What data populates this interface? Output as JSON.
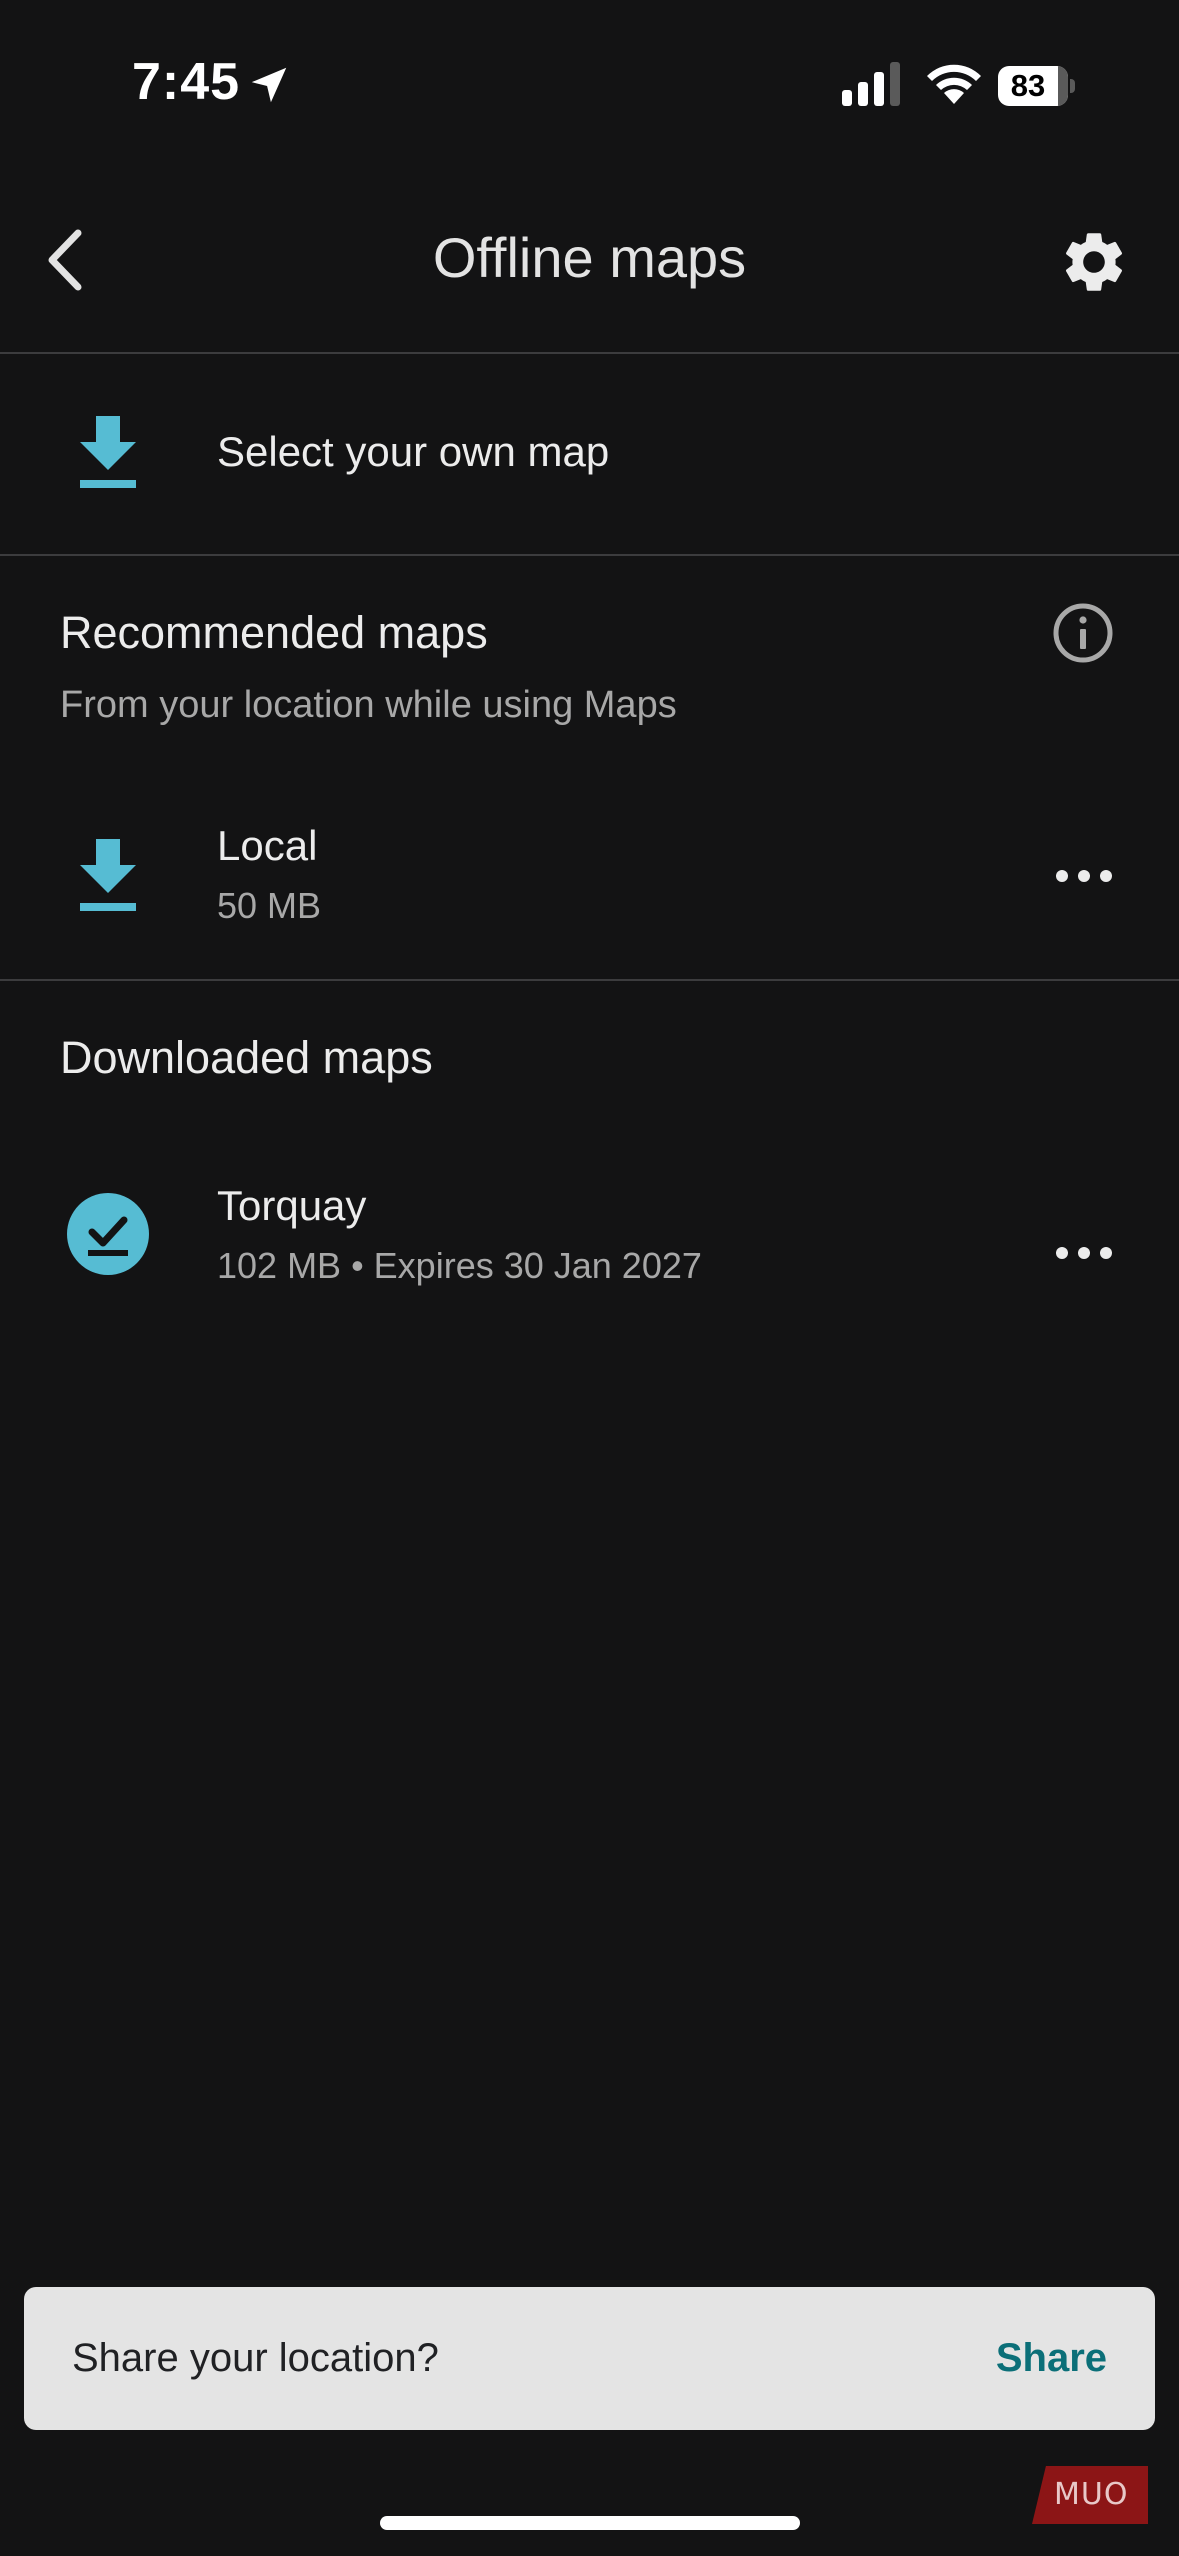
{
  "status_bar": {
    "time": "7:45",
    "battery": "83"
  },
  "header": {
    "title": "Offline maps"
  },
  "select_own_map": {
    "label": "Select your own map"
  },
  "recommended": {
    "title": "Recommended maps",
    "subtitle": "From your location while using Maps",
    "items": [
      {
        "name": "Local",
        "size": "50 MB"
      }
    ]
  },
  "downloaded": {
    "title": "Downloaded maps",
    "items": [
      {
        "name": "Torquay",
        "details": "102 MB • Expires 30 Jan 2027"
      }
    ]
  },
  "share_prompt": {
    "text": "Share your location?",
    "button": "Share"
  },
  "watermark": "MUO",
  "colors": {
    "background": "#131314",
    "accent": "#56bcd3",
    "share_button": "#0b6f78"
  }
}
